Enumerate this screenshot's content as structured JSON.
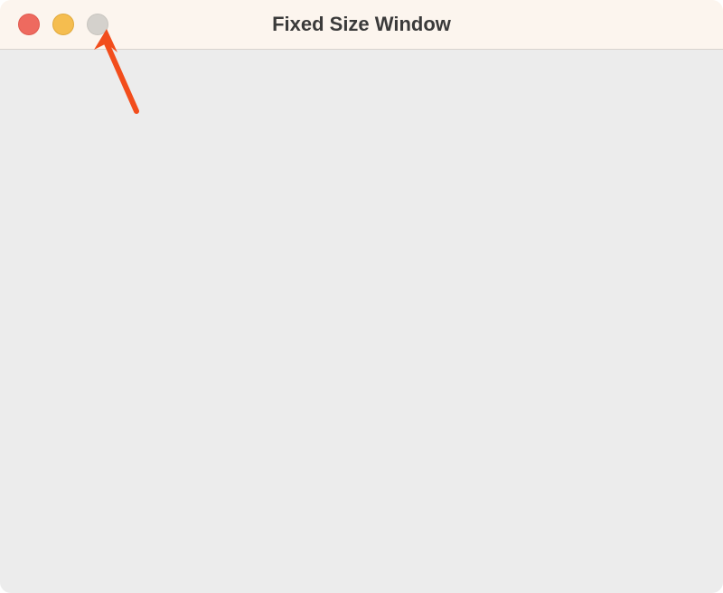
{
  "window": {
    "title": "Fixed Size Window"
  },
  "traffic_lights": {
    "close_color": "#ee6a5f",
    "minimize_color": "#f5bd4f",
    "zoom_color": "#d4d1cc",
    "zoom_disabled": true
  },
  "annotation": {
    "arrow_color": "#f24d1c",
    "target": "zoom-button"
  }
}
